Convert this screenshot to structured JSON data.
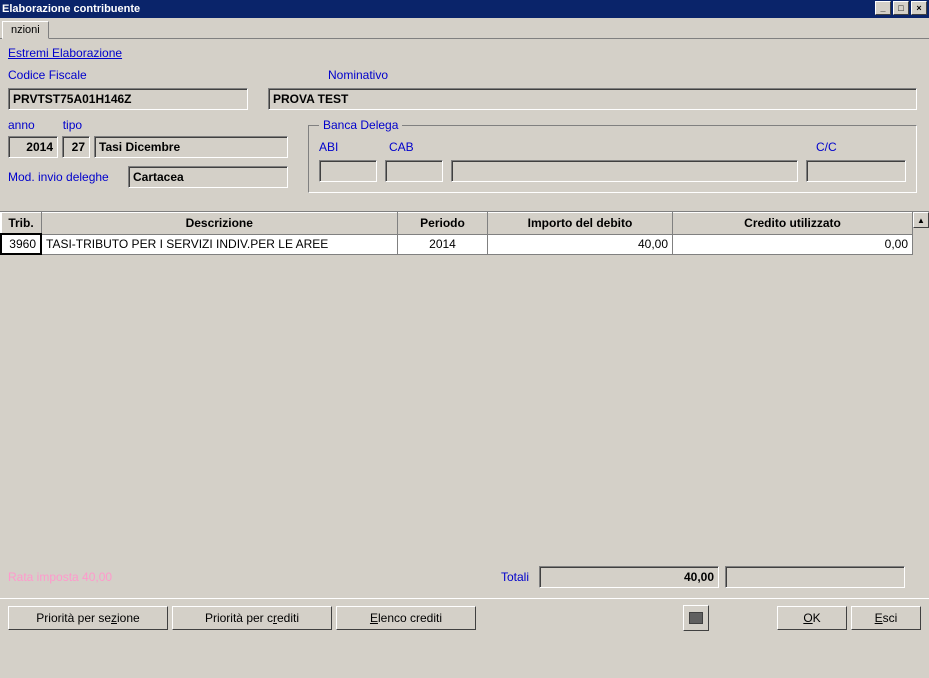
{
  "window": {
    "title": "Elaborazione contribuente"
  },
  "tab": {
    "label": "nzioni"
  },
  "section": "Estremi Elaborazione",
  "labels": {
    "codice_fiscale": "Codice Fiscale",
    "nominativo": "Nominativo",
    "anno": "anno",
    "tipo": "tipo",
    "mod_invio": "Mod. invio deleghe",
    "banca_delega": "Banca Delega",
    "abi": "ABI",
    "cab": "CAB",
    "cc": "C/C",
    "totali": "Totali"
  },
  "values": {
    "codice_fiscale": "PRVTST75A01H146Z",
    "nominativo": "PROVA TEST",
    "anno": "2014",
    "tipo": "27",
    "tipo_descr": "Tasi Dicembre",
    "mod_invio": "Cartacea",
    "abi": "",
    "cab": "",
    "descr_banca": "",
    "cc": ""
  },
  "hidden_footer": "Rata imposta    40,00",
  "table": {
    "headers": {
      "trib": "Trib.",
      "descrizione": "Descrizione",
      "periodo": "Periodo",
      "importo": "Importo del debito",
      "credito": "Credito utilizzato"
    },
    "rows": [
      {
        "trib": "3960",
        "descrizione": "TASI-TRIBUTO PER I SERVIZI INDIV.PER LE AREE",
        "periodo": "2014",
        "importo": "40,00",
        "credito": "0,00"
      }
    ],
    "totals": {
      "importo": "40,00",
      "credito": ""
    }
  },
  "buttons": {
    "priorita_sezione": "Priorità per sezione",
    "priorita_crediti": "Priorità per crediti",
    "elenco_crediti": "Elenco crediti",
    "ok": "OK",
    "esci": "Esci"
  }
}
